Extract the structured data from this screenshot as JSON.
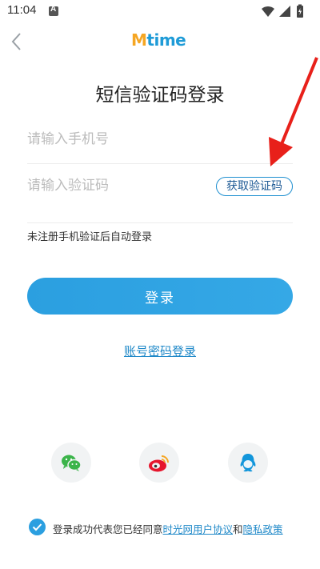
{
  "status_bar": {
    "time": "11:04",
    "icons": [
      "notification-a-icon",
      "wifi-icon",
      "cellular-signal-icon",
      "battery-charging-icon"
    ]
  },
  "header": {
    "back_icon": "chevron-left-icon",
    "logo_m": "M",
    "logo_rest": "time"
  },
  "title": "短信验证码登录",
  "phone_field": {
    "placeholder": "请输入手机号",
    "value": ""
  },
  "code_field": {
    "placeholder": "请输入验证码",
    "value": ""
  },
  "get_code_label": "获取验证码",
  "hint": "未注册手机验证后自动登录",
  "login_label": "登录",
  "password_login_label": "账号密码登录",
  "social": {
    "wechat_icon": "wechat-icon",
    "weibo_icon": "weibo-icon",
    "qq_icon": "qq-icon"
  },
  "agreement": {
    "checked": true,
    "prefix": "登录成功代表您已经同意",
    "user_agreement": "时光网用户协议",
    "and": "和",
    "privacy_policy": "隐私政策"
  },
  "colors": {
    "accent": "#2b9fe0",
    "logo_orange": "#f5a623",
    "annotation_red": "#e8201a"
  }
}
